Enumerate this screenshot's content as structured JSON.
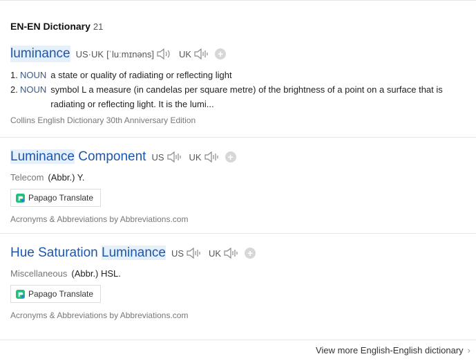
{
  "section": {
    "title": "EN-EN Dictionary",
    "count": "21"
  },
  "entries": [
    {
      "word": "luminance",
      "pron_region": "US·UK",
      "ipa": "[ˈluːmɪnəns]",
      "uk_label": "UK",
      "definitions": [
        {
          "num": "1.",
          "pos": "NOUN",
          "text": "a state or quality of radiating or reflecting light"
        },
        {
          "num": "2.",
          "pos": "NOUN",
          "text": "symbol L a measure (in candelas per square metre) of the brightness of a point on a surface that is radiating or reflecting light. It is the lumi..."
        }
      ],
      "source": "Collins English Dictionary 30th Anniversary Edition"
    },
    {
      "word_hl": "Luminance",
      "word_rest": " Component",
      "us_label": "US",
      "uk_label": "UK",
      "domain": "Telecom",
      "meaning": "(Abbr.) Y.",
      "translate_label": "Papago Translate",
      "source": "Acronyms & Abbreviations by Abbreviations.com"
    },
    {
      "word_pre": "Hue Saturation ",
      "word_hl": "Luminance",
      "us_label": "US",
      "uk_label": "UK",
      "domain": "Miscellaneous",
      "meaning": "(Abbr.) HSL.",
      "translate_label": "Papago Translate",
      "source": "Acronyms & Abbreviations by Abbreviations.com"
    }
  ],
  "more_link": "View more English-English dictionary",
  "icons": {
    "speaker": "speaker-icon",
    "plus": "add-icon",
    "papago": "papago-icon",
    "chevron": "chevron-right-icon"
  }
}
